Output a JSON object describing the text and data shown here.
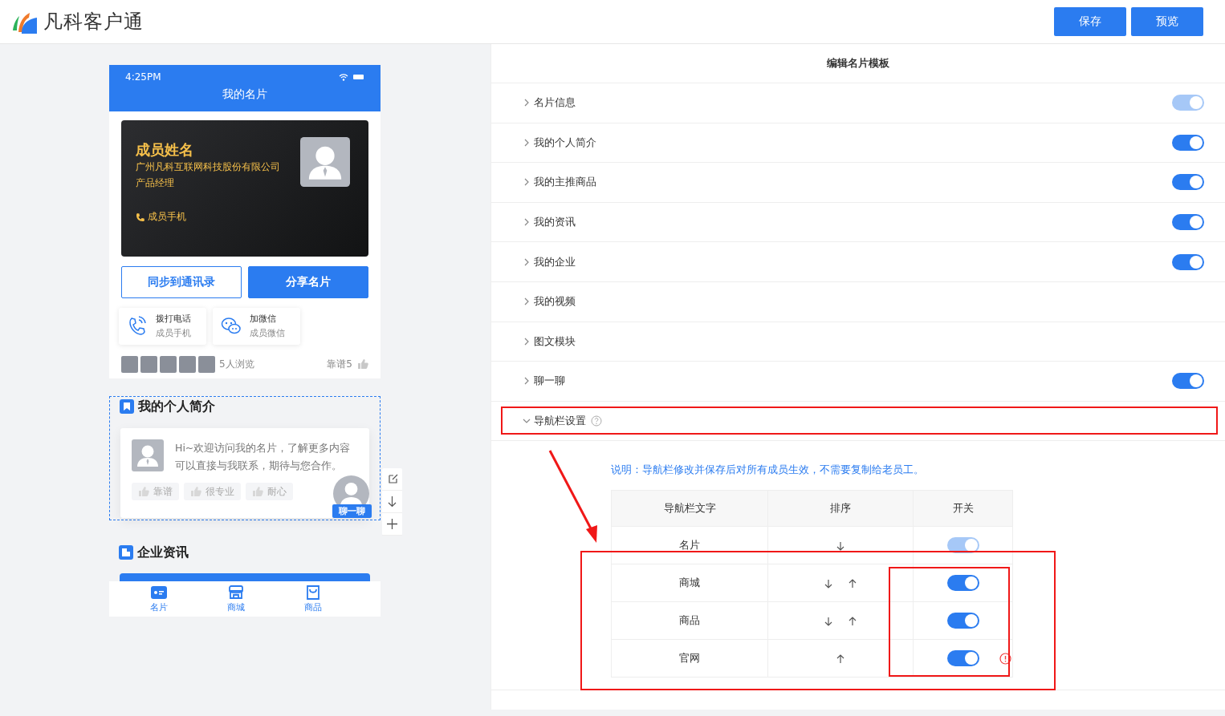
{
  "app": {
    "name": "凡科客户通"
  },
  "header_buttons": [
    "保存",
    "预览"
  ],
  "phone": {
    "time": "4:25PM",
    "title": "我的名片",
    "card": {
      "name": "成员姓名",
      "company": "广州凡科互联网科技股份有限公司",
      "position": "产品经理",
      "phone": "成员手机"
    },
    "buttons": [
      {
        "label": "同步到通讯录",
        "kind": "outline"
      },
      {
        "label": "分享名片",
        "kind": "filled"
      }
    ],
    "contacts": [
      {
        "kind": "phone",
        "title": "拨打电话",
        "subtitle": "成员手机"
      },
      {
        "kind": "wechat",
        "title": "加微信",
        "subtitle": "成员微信"
      }
    ],
    "views": "5人浏览",
    "likes": "靠谱5",
    "intro": {
      "title": "我的个人简介",
      "text": "Hi~欢迎访问我的名片，了解更多内容可以直接与我联系，期待与您合作。",
      "tags": [
        "靠谱",
        "很专业",
        "耐心"
      ],
      "chat_label": "聊一聊"
    },
    "news": {
      "title": "企业资讯"
    },
    "nav": [
      {
        "label": "名片",
        "kind": "card"
      },
      {
        "label": "商城",
        "kind": "store"
      },
      {
        "label": "商品",
        "kind": "bag"
      }
    ]
  },
  "editor": {
    "title": "编辑名片模板",
    "modules": [
      {
        "label": "名片信息",
        "expanded": false,
        "switch": {
          "on": true,
          "disabled": true
        }
      },
      {
        "label": "我的个人简介",
        "expanded": false,
        "switch": {
          "on": true,
          "disabled": false
        }
      },
      {
        "label": "我的主推商品",
        "expanded": false,
        "switch": {
          "on": true,
          "disabled": false
        }
      },
      {
        "label": "我的资讯",
        "expanded": false,
        "switch": {
          "on": true,
          "disabled": false
        }
      },
      {
        "label": "我的企业",
        "expanded": false,
        "switch": {
          "on": true,
          "disabled": false
        }
      },
      {
        "label": "我的视频",
        "expanded": false
      },
      {
        "label": "图文模块",
        "expanded": false
      },
      {
        "label": "聊一聊",
        "expanded": false,
        "switch": {
          "on": true,
          "disabled": false
        }
      }
    ],
    "nav_settings": {
      "label": "导航栏设置",
      "expanded": true,
      "note": "说明：导航栏修改并保存后对所有成员生效，不需要复制给老员工。",
      "columns": [
        "导航栏文字",
        "排序",
        "开关"
      ],
      "rows": [
        {
          "label": "名片",
          "move_down": true,
          "move_up": false,
          "switch": {
            "on": true,
            "disabled": true
          },
          "warning": false
        },
        {
          "label": "商城",
          "move_down": true,
          "move_up": true,
          "switch": {
            "on": true,
            "disabled": false
          },
          "warning": false
        },
        {
          "label": "商品",
          "move_down": true,
          "move_up": true,
          "switch": {
            "on": true,
            "disabled": false
          },
          "warning": false
        },
        {
          "label": "官网",
          "move_down": false,
          "move_up": true,
          "switch": {
            "on": true,
            "disabled": false
          },
          "warning": true
        }
      ]
    }
  }
}
